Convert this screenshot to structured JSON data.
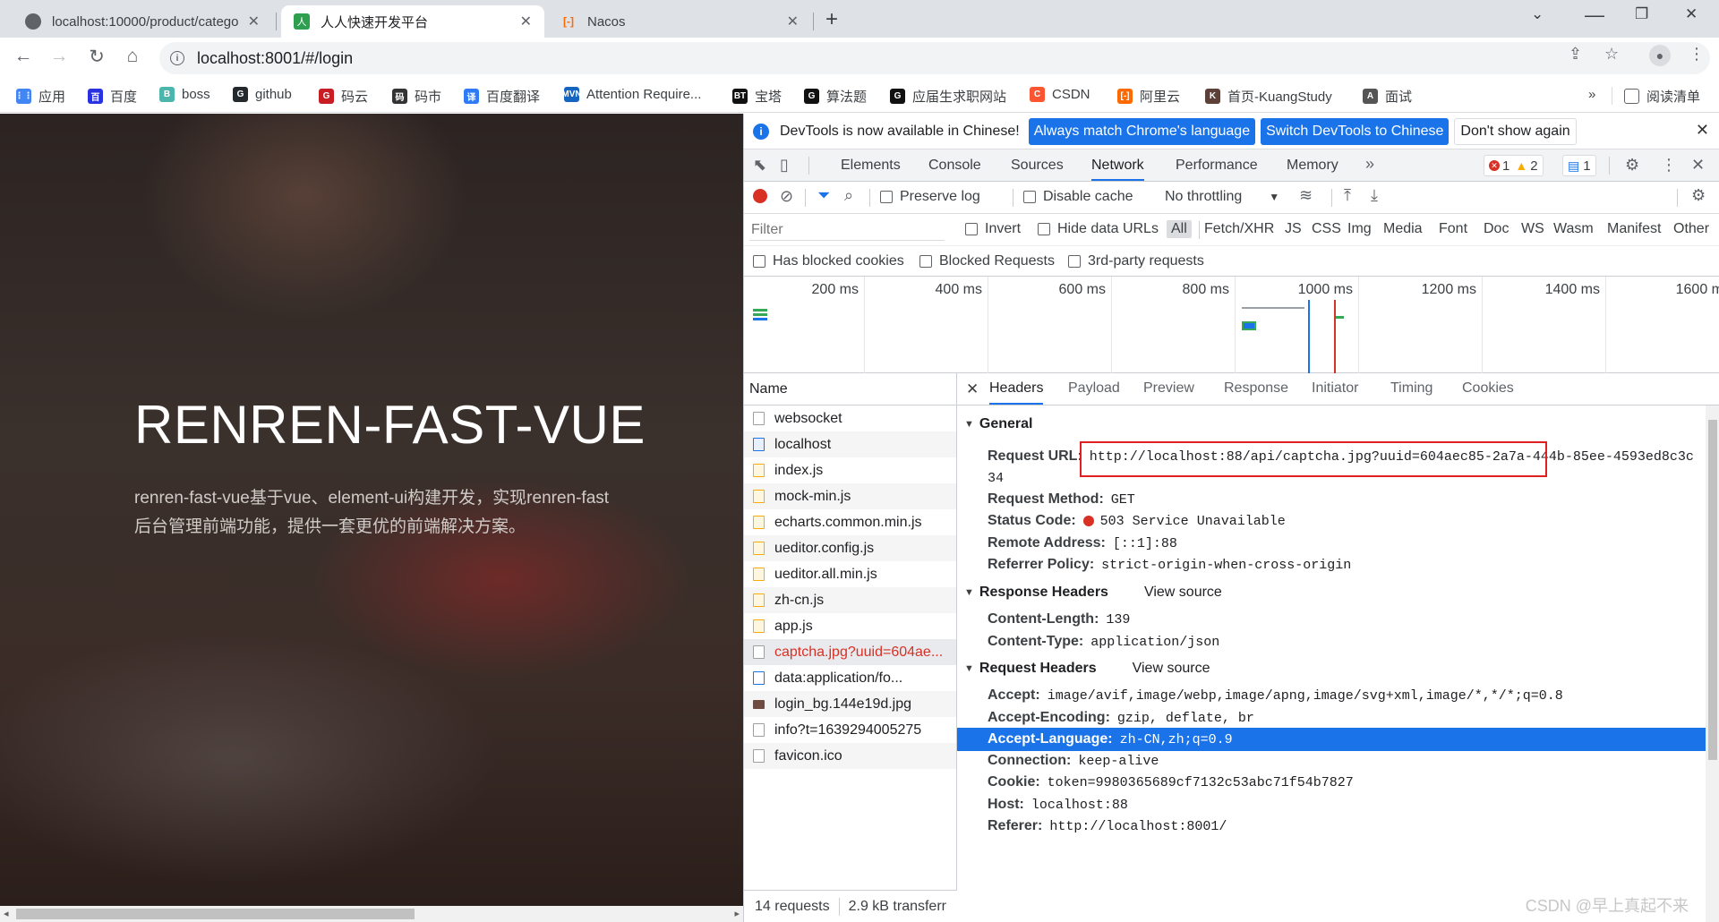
{
  "tabs": [
    {
      "title": "localhost:10000/product/catego",
      "favicon_color": "#5f6368",
      "favicon_glyph": ""
    },
    {
      "title": "人人快速开发平台",
      "favicon_color": "#2e9e4f",
      "favicon_glyph": "人"
    },
    {
      "title": "Nacos",
      "favicon_color": "#ff6a00",
      "favicon_glyph": "[-]"
    }
  ],
  "toolbar": {
    "url": "localhost:8001/#/login"
  },
  "bookmarks": [
    {
      "label": "应用",
      "color": "#4285f4",
      "glyph": "⋮⋮"
    },
    {
      "label": "百度",
      "color": "#2932e1",
      "glyph": "百"
    },
    {
      "label": "boss",
      "color": "#4db6ac",
      "glyph": "B"
    },
    {
      "label": "github",
      "color": "#24292e",
      "glyph": "G"
    },
    {
      "label": "码云",
      "color": "#c71d23",
      "glyph": "G"
    },
    {
      "label": "码市",
      "color": "#333333",
      "glyph": "码"
    },
    {
      "label": "百度翻译",
      "color": "#2f7bf7",
      "glyph": "译"
    },
    {
      "label": "Attention Require...",
      "color": "#1565c0",
      "glyph": "MVN"
    },
    {
      "label": "宝塔",
      "color": "#111111",
      "glyph": "BT"
    },
    {
      "label": "算法题",
      "color": "#111111",
      "glyph": "G"
    },
    {
      "label": "应届生求职网站",
      "color": "#111111",
      "glyph": "G"
    },
    {
      "label": "CSDN",
      "color": "#fc5531",
      "glyph": "C"
    },
    {
      "label": "阿里云",
      "color": "#ff6a00",
      "glyph": "[-]"
    },
    {
      "label": "首页-KuangStudy",
      "color": "#5d4037",
      "glyph": "K"
    },
    {
      "label": "面试",
      "color": "#555555",
      "glyph": "A"
    }
  ],
  "bookmarks_more": "»",
  "reading_list": "阅读清单",
  "page": {
    "title": "RENREN-FAST-VUE",
    "desc_line1": "renren-fast-vue基于vue、element-ui构建开发，实现renren-fast",
    "desc_line2": "后台管理前端功能，提供一套更优的前端解决方案。"
  },
  "devtools": {
    "infobar": {
      "message": "DevTools is now available in Chinese!",
      "btn_match": "Always match Chrome's language",
      "btn_switch": "Switch DevTools to Chinese",
      "btn_dont_show": "Don't show again"
    },
    "panel_tabs": [
      "Elements",
      "Console",
      "Sources",
      "Network",
      "Performance",
      "Memory"
    ],
    "active_panel": "Network",
    "badges": {
      "errors": "1",
      "warnings": "2",
      "messages": "1"
    },
    "net_toolbar": {
      "preserve_log": "Preserve log",
      "disable_cache": "Disable cache",
      "throttling": "No throttling"
    },
    "filter": {
      "placeholder": "Filter",
      "invert": "Invert",
      "hide_data_urls": "Hide data URLs",
      "types": [
        "All",
        "Fetch/XHR",
        "JS",
        "CSS",
        "Img",
        "Media",
        "Font",
        "Doc",
        "WS",
        "Wasm",
        "Manifest",
        "Other"
      ]
    },
    "blocked_row": {
      "has_blocked_cookies": "Has blocked cookies",
      "blocked_requests": "Blocked Requests",
      "third_party": "3rd-party requests"
    },
    "overview_ticks": [
      "200 ms",
      "400 ms",
      "600 ms",
      "800 ms",
      "1000 ms",
      "1200 ms",
      "1400 ms",
      "1600 m"
    ],
    "name_header": "Name",
    "requests": [
      {
        "name": "websocket",
        "type": "other"
      },
      {
        "name": "localhost",
        "type": "doc"
      },
      {
        "name": "index.js",
        "type": "js"
      },
      {
        "name": "mock-min.js",
        "type": "js"
      },
      {
        "name": "echarts.common.min.js",
        "type": "js"
      },
      {
        "name": "ueditor.config.js",
        "type": "js"
      },
      {
        "name": "ueditor.all.min.js",
        "type": "js"
      },
      {
        "name": "zh-cn.js",
        "type": "js"
      },
      {
        "name": "app.js",
        "type": "js"
      },
      {
        "name": "captcha.jpg?uuid=604ae...",
        "type": "err"
      },
      {
        "name": "data:application/fo...",
        "type": "font"
      },
      {
        "name": "login_bg.144e19d.jpg",
        "type": "img"
      },
      {
        "name": "info?t=1639294005275",
        "type": "other"
      },
      {
        "name": "favicon.ico",
        "type": "other"
      }
    ],
    "footer": {
      "requests": "14 requests",
      "transferred": "2.9 kB transferr"
    },
    "detail_tabs": [
      "Headers",
      "Payload",
      "Preview",
      "Response",
      "Initiator",
      "Timing",
      "Cookies"
    ],
    "active_detail_tab": "Headers",
    "general": {
      "title": "General",
      "request_url_label": "Request URL:",
      "request_url": "http://localhost:88/api/captcha.jpg?uuid=604aec85-2a7a-444b-85ee-4593ed8c3c",
      "request_url_wrap": "34",
      "method_label": "Request Method:",
      "method": "GET",
      "status_label": "Status Code:",
      "status": "503 Service Unavailable",
      "remote_label": "Remote Address:",
      "remote": "[::1]:88",
      "referrer_label": "Referrer Policy:",
      "referrer": "strict-origin-when-cross-origin"
    },
    "response_headers": {
      "title": "Response Headers",
      "view_source": "View source",
      "rows": [
        {
          "k": "Content-Length:",
          "v": "139"
        },
        {
          "k": "Content-Type:",
          "v": "application/json"
        }
      ]
    },
    "request_headers": {
      "title": "Request Headers",
      "view_source": "View source",
      "rows": [
        {
          "k": "Accept:",
          "v": "image/avif,image/webp,image/apng,image/svg+xml,image/*,*/*;q=0.8"
        },
        {
          "k": "Accept-Encoding:",
          "v": "gzip, deflate, br"
        },
        {
          "k": "Accept-Language:",
          "v": "zh-CN,zh;q=0.9"
        },
        {
          "k": "Connection:",
          "v": "keep-alive"
        },
        {
          "k": "Cookie:",
          "v": "token=9980365689cf7132c53abc71f54b7827"
        },
        {
          "k": "Host:",
          "v": "localhost:88"
        },
        {
          "k": "Referer:",
          "v": "http://localhost:8001/"
        }
      ]
    }
  },
  "watermark": "CSDN @早上真起不来"
}
